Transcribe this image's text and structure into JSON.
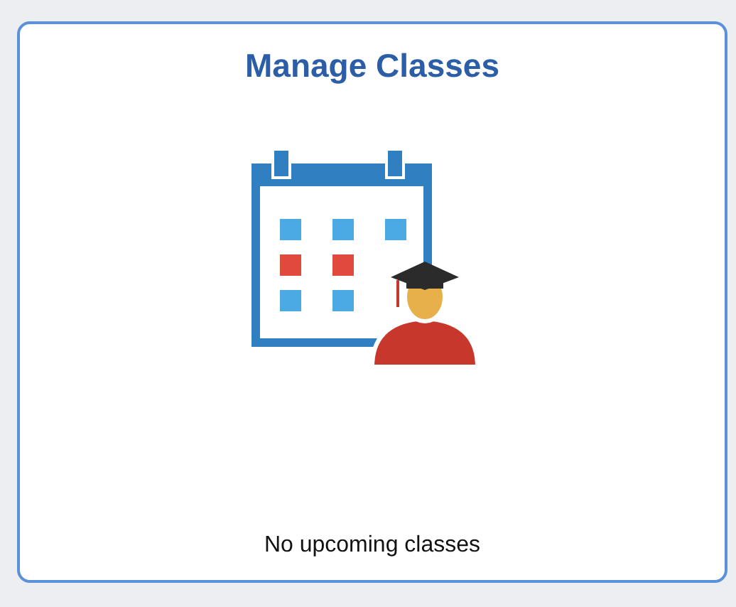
{
  "tile": {
    "title": "Manage Classes",
    "message": "No upcoming classes"
  }
}
